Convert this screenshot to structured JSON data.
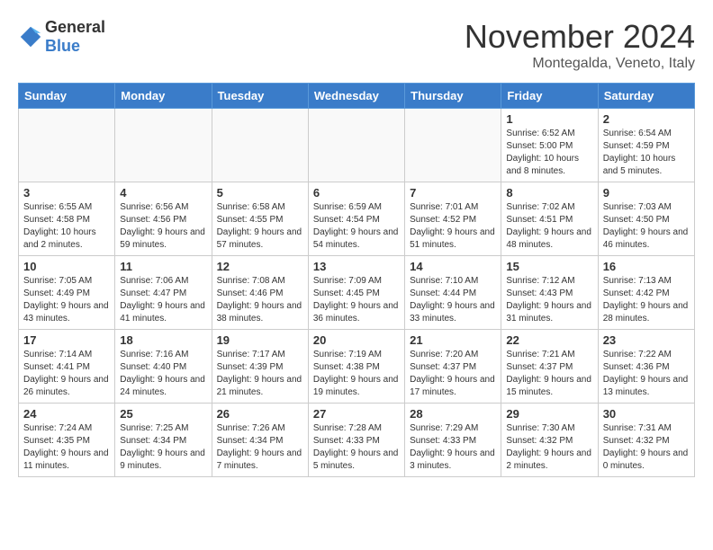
{
  "logo": {
    "general": "General",
    "blue": "Blue"
  },
  "title": "November 2024",
  "subtitle": "Montegalda, Veneto, Italy",
  "days_of_week": [
    "Sunday",
    "Monday",
    "Tuesday",
    "Wednesday",
    "Thursday",
    "Friday",
    "Saturday"
  ],
  "weeks": [
    [
      {
        "day": "",
        "info": ""
      },
      {
        "day": "",
        "info": ""
      },
      {
        "day": "",
        "info": ""
      },
      {
        "day": "",
        "info": ""
      },
      {
        "day": "",
        "info": ""
      },
      {
        "day": "1",
        "info": "Sunrise: 6:52 AM\nSunset: 5:00 PM\nDaylight: 10 hours and 8 minutes."
      },
      {
        "day": "2",
        "info": "Sunrise: 6:54 AM\nSunset: 4:59 PM\nDaylight: 10 hours and 5 minutes."
      }
    ],
    [
      {
        "day": "3",
        "info": "Sunrise: 6:55 AM\nSunset: 4:58 PM\nDaylight: 10 hours and 2 minutes."
      },
      {
        "day": "4",
        "info": "Sunrise: 6:56 AM\nSunset: 4:56 PM\nDaylight: 9 hours and 59 minutes."
      },
      {
        "day": "5",
        "info": "Sunrise: 6:58 AM\nSunset: 4:55 PM\nDaylight: 9 hours and 57 minutes."
      },
      {
        "day": "6",
        "info": "Sunrise: 6:59 AM\nSunset: 4:54 PM\nDaylight: 9 hours and 54 minutes."
      },
      {
        "day": "7",
        "info": "Sunrise: 7:01 AM\nSunset: 4:52 PM\nDaylight: 9 hours and 51 minutes."
      },
      {
        "day": "8",
        "info": "Sunrise: 7:02 AM\nSunset: 4:51 PM\nDaylight: 9 hours and 48 minutes."
      },
      {
        "day": "9",
        "info": "Sunrise: 7:03 AM\nSunset: 4:50 PM\nDaylight: 9 hours and 46 minutes."
      }
    ],
    [
      {
        "day": "10",
        "info": "Sunrise: 7:05 AM\nSunset: 4:49 PM\nDaylight: 9 hours and 43 minutes."
      },
      {
        "day": "11",
        "info": "Sunrise: 7:06 AM\nSunset: 4:47 PM\nDaylight: 9 hours and 41 minutes."
      },
      {
        "day": "12",
        "info": "Sunrise: 7:08 AM\nSunset: 4:46 PM\nDaylight: 9 hours and 38 minutes."
      },
      {
        "day": "13",
        "info": "Sunrise: 7:09 AM\nSunset: 4:45 PM\nDaylight: 9 hours and 36 minutes."
      },
      {
        "day": "14",
        "info": "Sunrise: 7:10 AM\nSunset: 4:44 PM\nDaylight: 9 hours and 33 minutes."
      },
      {
        "day": "15",
        "info": "Sunrise: 7:12 AM\nSunset: 4:43 PM\nDaylight: 9 hours and 31 minutes."
      },
      {
        "day": "16",
        "info": "Sunrise: 7:13 AM\nSunset: 4:42 PM\nDaylight: 9 hours and 28 minutes."
      }
    ],
    [
      {
        "day": "17",
        "info": "Sunrise: 7:14 AM\nSunset: 4:41 PM\nDaylight: 9 hours and 26 minutes."
      },
      {
        "day": "18",
        "info": "Sunrise: 7:16 AM\nSunset: 4:40 PM\nDaylight: 9 hours and 24 minutes."
      },
      {
        "day": "19",
        "info": "Sunrise: 7:17 AM\nSunset: 4:39 PM\nDaylight: 9 hours and 21 minutes."
      },
      {
        "day": "20",
        "info": "Sunrise: 7:19 AM\nSunset: 4:38 PM\nDaylight: 9 hours and 19 minutes."
      },
      {
        "day": "21",
        "info": "Sunrise: 7:20 AM\nSunset: 4:37 PM\nDaylight: 9 hours and 17 minutes."
      },
      {
        "day": "22",
        "info": "Sunrise: 7:21 AM\nSunset: 4:37 PM\nDaylight: 9 hours and 15 minutes."
      },
      {
        "day": "23",
        "info": "Sunrise: 7:22 AM\nSunset: 4:36 PM\nDaylight: 9 hours and 13 minutes."
      }
    ],
    [
      {
        "day": "24",
        "info": "Sunrise: 7:24 AM\nSunset: 4:35 PM\nDaylight: 9 hours and 11 minutes."
      },
      {
        "day": "25",
        "info": "Sunrise: 7:25 AM\nSunset: 4:34 PM\nDaylight: 9 hours and 9 minutes."
      },
      {
        "day": "26",
        "info": "Sunrise: 7:26 AM\nSunset: 4:34 PM\nDaylight: 9 hours and 7 minutes."
      },
      {
        "day": "27",
        "info": "Sunrise: 7:28 AM\nSunset: 4:33 PM\nDaylight: 9 hours and 5 minutes."
      },
      {
        "day": "28",
        "info": "Sunrise: 7:29 AM\nSunset: 4:33 PM\nDaylight: 9 hours and 3 minutes."
      },
      {
        "day": "29",
        "info": "Sunrise: 7:30 AM\nSunset: 4:32 PM\nDaylight: 9 hours and 2 minutes."
      },
      {
        "day": "30",
        "info": "Sunrise: 7:31 AM\nSunset: 4:32 PM\nDaylight: 9 hours and 0 minutes."
      }
    ]
  ]
}
